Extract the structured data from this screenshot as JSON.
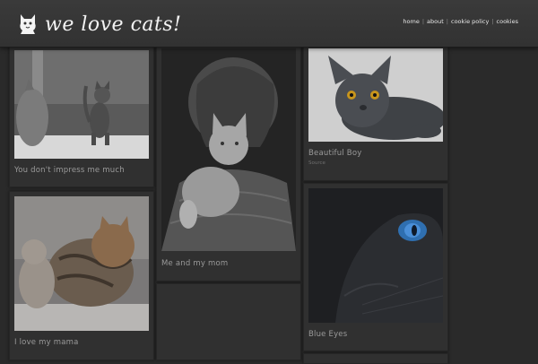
{
  "site": {
    "title": "we love cats!",
    "logo_icon": "cat-silhouette-icon"
  },
  "nav": [
    {
      "label": "home"
    },
    {
      "label": "about"
    },
    {
      "label": "cookie policy"
    },
    {
      "label": "cookies"
    }
  ],
  "posts": [
    {
      "caption": "You don't impress me much"
    },
    {
      "caption": "I love my mama"
    },
    {
      "caption": "Me and my mom"
    },
    {
      "caption": "Beautiful Boy",
      "source": "Source"
    },
    {
      "caption": "Blue Eyes"
    }
  ],
  "colors": {
    "background": "#2a2a2a",
    "card": "#303030",
    "header": "#353535",
    "accent_eye": "#4a8fd8"
  }
}
